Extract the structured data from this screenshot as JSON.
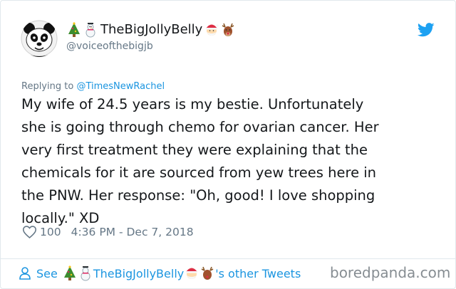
{
  "tweet": {
    "display_name": "TheBigJollyBelly",
    "handle": "@voiceofthebigjb",
    "reply_prefix": "Replying to ",
    "reply_to": "@TimesNewRachel",
    "text": "My wife of 24.5 years is my bestie. Unfortunately\nshe is going through chemo for ovarian cancer. Her\nvery first treatment they were explaining that the\nchemicals for it are sourced from yew trees here in\nthe PNW. Her response: \"Oh, good! I love shopping\nlocally.\" XD",
    "likes": "100",
    "timestamp": "4:36 PM - Dec 7, 2018"
  },
  "footer": {
    "see": "See",
    "name": "TheBigJollyBelly",
    "suffix": "'s other Tweets"
  },
  "watermark": "boredpanda.com",
  "icons": {
    "avatar": "panda-avatar-icon",
    "twitter": "twitter-bird-icon",
    "like": "heart-icon",
    "user": "person-icon",
    "emoji": [
      "christmas-tree-icon",
      "snowman-icon",
      "santa-icon",
      "reindeer-icon"
    ]
  },
  "colors": {
    "link": "#1b95e0",
    "secondary_text": "#657786",
    "text": "#14171a",
    "border": "#e1e8ed"
  }
}
